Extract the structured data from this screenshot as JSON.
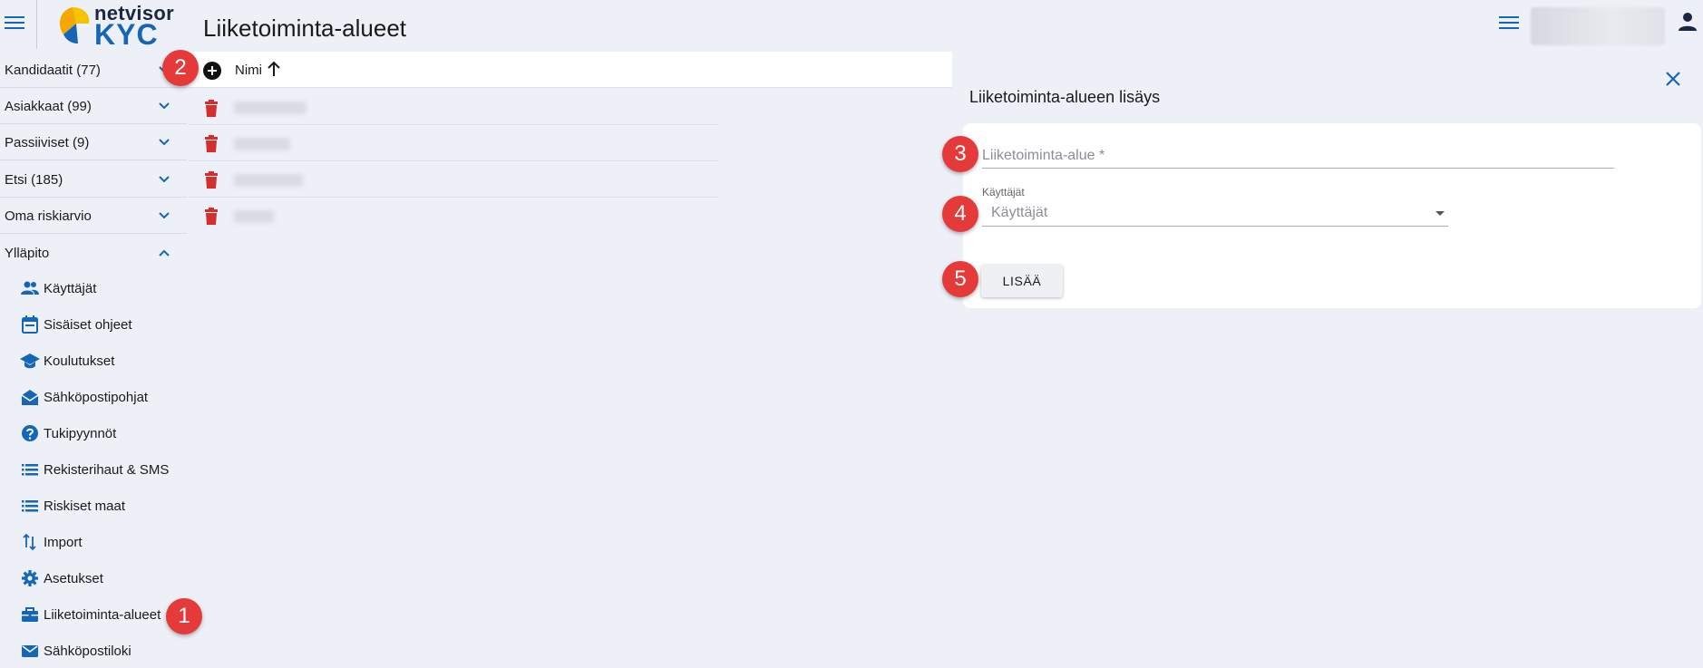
{
  "header": {
    "logo_line1": "netvisor",
    "logo_line2": "KYC",
    "page_title": "Liiketoiminta-alueet"
  },
  "sidebar": {
    "groups": [
      {
        "label": "Kandidaatit (77)",
        "icon": "chevron-down-icon"
      },
      {
        "label": "Asiakkaat (99)",
        "icon": "chevron-down-icon"
      },
      {
        "label": "Passiiviset (9)",
        "icon": "chevron-down-icon"
      },
      {
        "label": "Etsi (185)",
        "icon": "chevron-down-icon"
      },
      {
        "label": "Oma riskiarvio",
        "icon": "chevron-down-icon"
      },
      {
        "label": "Ylläpito",
        "icon": "chevron-up-icon"
      }
    ],
    "items": [
      {
        "label": "Käyttäjät",
        "icon": "people-icon"
      },
      {
        "label": "Sisäiset ohjeet",
        "icon": "calendar-icon"
      },
      {
        "label": "Koulutukset",
        "icon": "school-icon"
      },
      {
        "label": "Sähköpostipohjat",
        "icon": "drafts-icon"
      },
      {
        "label": "Tukipyynnöt",
        "icon": "help-icon"
      },
      {
        "label": "Rekisterihaut & SMS",
        "icon": "list-icon"
      },
      {
        "label": "Riskiset maat",
        "icon": "list-icon"
      },
      {
        "label": "Import",
        "icon": "import-arrows-icon"
      },
      {
        "label": "Asetukset",
        "icon": "gear-icon"
      },
      {
        "label": "Liiketoiminta-alueet",
        "icon": "briefcase-icon"
      },
      {
        "label": "Sähköpostiloki",
        "icon": "mail-icon"
      }
    ]
  },
  "table": {
    "column_name": "Nimi",
    "sort": "ascending"
  },
  "panel": {
    "title": "Liiketoiminta-alueen lisäys",
    "field_name_placeholder": "Liiketoiminta-alue *",
    "users_label": "Käyttäjät",
    "users_placeholder": "Käyttäjät",
    "add_button": "LISÄÄ"
  },
  "badges": [
    "1",
    "2",
    "3",
    "4",
    "5"
  ],
  "colors": {
    "accent": "#1666b8",
    "delete": "#d32f2f",
    "badge": "#e43a3a",
    "background": "#edf0f7"
  }
}
